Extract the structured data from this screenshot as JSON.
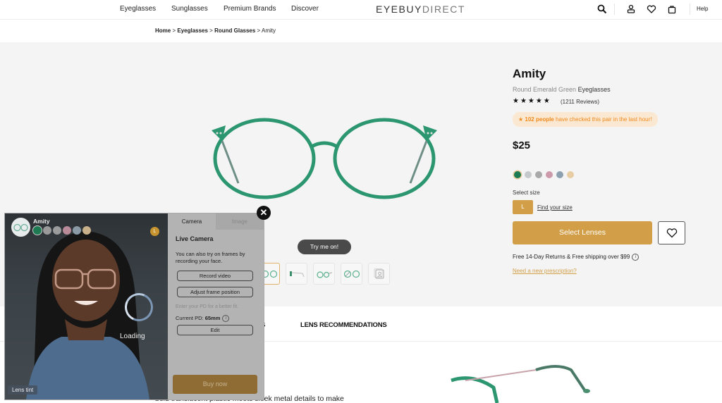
{
  "nav": {
    "links": [
      "Eyeglasses",
      "Sunglasses",
      "Premium Brands",
      "Discover"
    ],
    "logo_main": "EYEBUY",
    "logo_light": "DIRECT",
    "help": "Help",
    "icons": [
      "search-icon",
      "account-icon",
      "heart-icon",
      "bag-icon"
    ]
  },
  "breadcrumb": {
    "items": [
      "Home",
      "Eyeglasses",
      "Round Glasses"
    ],
    "current": "Amity",
    "separator": " > "
  },
  "gallery": {
    "try_on_label": "Try me on!",
    "thumbnails": [
      "front-view",
      "side-view",
      "angle-view",
      "front-angle-view",
      "photo-try-on"
    ]
  },
  "product": {
    "name": "Amity",
    "subtitle_prefix": "Round Emerald Green ",
    "subtitle_type": "Eyeglasses",
    "stars": "★★★★★",
    "rating": 5,
    "reviews": "(1211 Reviews)",
    "hot_badge_count": "102 people",
    "hot_badge_text": " have checked this pair in the last hour!",
    "price": "$25",
    "colors": [
      "#1d7a52",
      "#c5c9cc",
      "#a9a9a9",
      "#cc9aaa",
      "#8da0b0",
      "#e8cda4"
    ],
    "selected_color_index": 0,
    "size_label": "Select size",
    "size": "L",
    "find_size": "Find your size",
    "select_lenses": "Select Lenses",
    "shipping": "Free 14-Day Returns & Free shipping over $99",
    "prescription_link": "Need a new prescription?"
  },
  "tabs": {
    "partial": "S",
    "lens_recommendations": "LENS RECOMMENDATIONS"
  },
  "description": "bold translucent plastic meets sleek metal details to make",
  "tryon": {
    "frame_name": "Amity",
    "colors": [
      "#1d7a52",
      "#9a9a9a",
      "#9c9c9c",
      "#b98a98",
      "#8a9aa6",
      "#c7b08a"
    ],
    "size_chip": "L",
    "loading": "Loading",
    "lens_tint": "Lens tint",
    "tab_camera": "Camera",
    "tab_image": "Image",
    "heading": "Live Camera",
    "text": "You can also try on frames by recording your face.",
    "record_video": "Record video",
    "adjust_frame": "Adjust frame position",
    "pd_hint": "Enter your PD for a better fit.",
    "pd_label": "Current PD: ",
    "pd_value": "65mm",
    "edit": "Edit",
    "buy_now": "Buy now",
    "close": "✕"
  }
}
